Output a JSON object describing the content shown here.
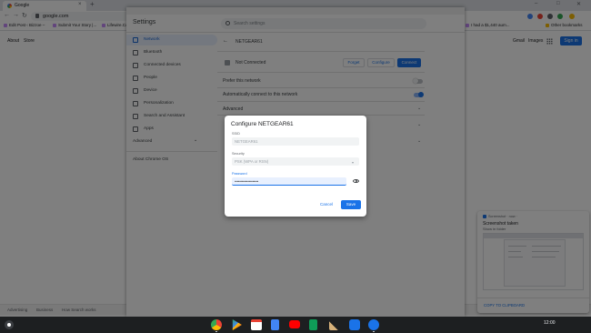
{
  "browser": {
    "tab_title": "Google",
    "tab_close": "×",
    "new_tab": "+",
    "url": "google.com",
    "window_controls": [
      "–",
      "□",
      "✕"
    ],
    "nav": [
      "←",
      "→",
      "↻"
    ],
    "bookmarks": [
      "Edit Post ‹ Bizzoe –",
      "Submit Your Story |...",
      "Lifewire.Com",
      "I had a $1,440 aum..."
    ],
    "other_bookmarks": "Other bookmarks"
  },
  "google": {
    "left_links": [
      "About",
      "Store"
    ],
    "right_links": [
      "Gmail",
      "Images"
    ],
    "sign_in": "Sign in",
    "footer": [
      "Advertising",
      "Business",
      "How Search works"
    ]
  },
  "settings": {
    "title": "Settings",
    "search_placeholder": "Search settings",
    "sidebar": [
      {
        "label": "Network",
        "icon": "wifi-icon",
        "active": true
      },
      {
        "label": "Bluetooth",
        "icon": "bluetooth-icon",
        "active": false
      },
      {
        "label": "Connected devices",
        "icon": "phone-icon",
        "active": false
      },
      {
        "label": "People",
        "icon": "person-icon",
        "active": false
      },
      {
        "label": "Device",
        "icon": "laptop-icon",
        "active": false
      },
      {
        "label": "Personalization",
        "icon": "brush-icon",
        "active": false
      },
      {
        "label": "Search and Assistant",
        "icon": "search-icon",
        "active": false
      },
      {
        "label": "Apps",
        "icon": "apps-icon",
        "active": false
      }
    ],
    "advanced": "Advanced",
    "about": "About Chrome OS",
    "back_arrow": "←",
    "network_name": "NETGEAR61",
    "status": "Not Connected",
    "buttons": {
      "forget": "Forget",
      "configure": "Configure",
      "connect": "Connect"
    },
    "prefer": "Prefer this network",
    "auto_connect": "Automatically connect to this network",
    "advanced_section": "Advanced",
    "chevron": "⌄"
  },
  "dialog": {
    "title": "Configure NETGEAR61",
    "ssid_label": "SSID",
    "ssid_value": "NETGEAR61",
    "security_label": "Security",
    "security_value": "PSK (WPA or RSN)",
    "security_arrow": "▾",
    "password_label": "Password",
    "password_value": "••••••••••••••••••••",
    "cancel": "Cancel",
    "save": "Save"
  },
  "notification": {
    "app": "Screenshot",
    "time": "· now ·",
    "title": "Screenshot taken",
    "subtitle": "Show in folder",
    "action": "COPY TO CLIPBOARD"
  },
  "shelf": {
    "apps": [
      "chrome-icon",
      "play-store-icon",
      "gmail-icon",
      "docs-icon",
      "youtube-icon",
      "sheets-icon",
      "broom-icon",
      "files-icon",
      "settings-icon"
    ],
    "tray": "12:00"
  },
  "colors": {
    "accent": "#1a73e8",
    "scrim": "rgba(0,0,0,0.5)"
  }
}
